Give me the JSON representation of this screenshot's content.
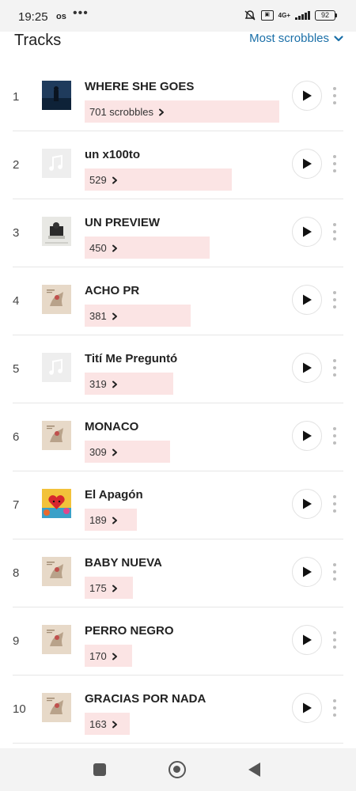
{
  "status_bar": {
    "time": "19:25",
    "os_badge": "os",
    "dots": "•••",
    "sim_label": "VoLTE",
    "network": "4G+",
    "battery": "92"
  },
  "header": {
    "title": "Tracks",
    "sort_label": "Most scrobbles"
  },
  "tracks": [
    {
      "rank": "1",
      "name": "WHERE SHE GOES",
      "scrobbles": "701 scrobbles",
      "count": 701,
      "cover": "dark-blue-photo"
    },
    {
      "rank": "2",
      "name": "un x100to",
      "scrobbles": "529",
      "count": 529,
      "cover": "placeholder-note"
    },
    {
      "rank": "3",
      "name": "UN PREVIEW",
      "scrobbles": "450",
      "count": 450,
      "cover": "light-photo"
    },
    {
      "rank": "4",
      "name": "ACHO PR",
      "scrobbles": "381",
      "count": 381,
      "cover": "beige-horse-art"
    },
    {
      "rank": "5",
      "name": "Tití Me Preguntó",
      "scrobbles": "319",
      "count": 319,
      "cover": "placeholder-note"
    },
    {
      "rank": "6",
      "name": "MONACO",
      "scrobbles": "309",
      "count": 309,
      "cover": "beige-horse-art"
    },
    {
      "rank": "7",
      "name": "El Apagón",
      "scrobbles": "189",
      "count": 189,
      "cover": "red-heart-art"
    },
    {
      "rank": "8",
      "name": "BABY NUEVA",
      "scrobbles": "175",
      "count": 175,
      "cover": "beige-horse-art"
    },
    {
      "rank": "9",
      "name": "PERRO NEGRO",
      "scrobbles": "170",
      "count": 170,
      "cover": "beige-horse-art"
    },
    {
      "rank": "10",
      "name": "GRACIAS POR NADA",
      "scrobbles": "163",
      "count": 163,
      "cover": "beige-horse-art"
    }
  ],
  "colors": {
    "accent": "#1a6fa8",
    "scrobble_bar": "#fbe4e4"
  }
}
